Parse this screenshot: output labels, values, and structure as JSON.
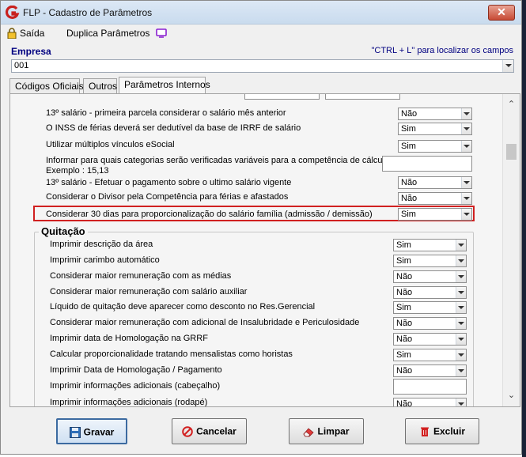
{
  "window": {
    "title": "FLP - Cadastro de Parâmetros",
    "close_label": "✕"
  },
  "toolbar": {
    "saida_label": "Saída",
    "duplica_label": "Duplica Parâmetros"
  },
  "empresa": {
    "label": "Empresa",
    "hint": "\"CTRL + L\" para localizar os campos",
    "value": "001"
  },
  "tabs": [
    {
      "label": "Códigos Oficiais"
    },
    {
      "label": "Outros"
    },
    {
      "label": "Parâmetros Internos"
    }
  ],
  "params": [
    {
      "label": "13º salário - primeira parcela considerar o salário mês anterior",
      "value": "Não"
    },
    {
      "label": "O INSS de férias deverá ser dedutível da base de IRRF de salário",
      "value": "Sim"
    },
    {
      "label": "Utilizar múltiplos vínculos eSocial",
      "value": "Sim"
    },
    {
      "label": "Informar para quais categorias serão verificadas variáveis para a competência de cálculo.",
      "label2": "Exemplo : 15,13",
      "value": ""
    },
    {
      "label": "13º salário - Efetuar o pagamento sobre o ultimo salário vigente",
      "value": "Não"
    },
    {
      "label": "Considerar o Divisor pela Competência para férias e afastados",
      "value": "Não"
    },
    {
      "label": "Considerar 30 dias para proporcionalização do salário família (admissão / demissão)",
      "value": "Sim"
    }
  ],
  "quitacao": {
    "title": "Quitação",
    "items": [
      {
        "label": "Imprimir descrição da área",
        "value": "Sim"
      },
      {
        "label": "Imprimir carimbo automático",
        "value": "Sim"
      },
      {
        "label": "Considerar maior remuneração com as médias",
        "value": "Não"
      },
      {
        "label": "Considerar maior remuneração com salário auxiliar",
        "value": "Não"
      },
      {
        "label": "Líquido de quitação deve aparecer como desconto no Res.Gerencial",
        "value": "Sim"
      },
      {
        "label": "Considerar maior remuneração com adicional de Insalubridade e Periculosidade",
        "value": "Não"
      },
      {
        "label": "Imprimir data de Homologação na GRRF",
        "value": "Não"
      },
      {
        "label": "Calcular proporcionalidade tratando mensalistas como horistas",
        "value": "Sim"
      },
      {
        "label": "Imprimir Data de  Homologação / Pagamento",
        "value": "Não"
      },
      {
        "label": "Imprimir informações adicionais (cabeçalho)",
        "value": ""
      },
      {
        "label": "Imprimir informações adicionais (rodapé)",
        "value": "Não"
      }
    ]
  },
  "buttons": {
    "gravar": "Gravar",
    "cancelar": "Cancelar",
    "limpar": "Limpar",
    "excluir": "Excluir"
  },
  "colors": {
    "highlight": "#d02020",
    "title_blue": "#000080"
  }
}
